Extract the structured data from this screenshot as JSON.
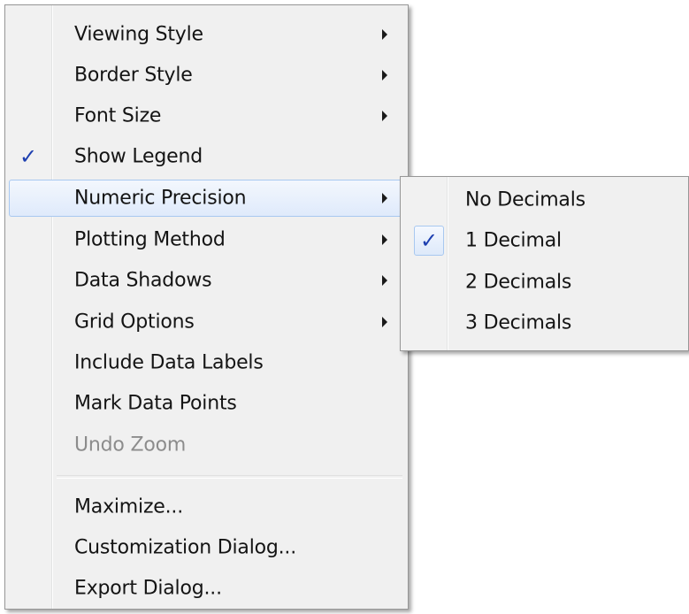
{
  "main_menu": {
    "items": [
      {
        "label": "Viewing Style",
        "has_submenu": true
      },
      {
        "label": "Border Style",
        "has_submenu": true
      },
      {
        "label": "Font Size",
        "has_submenu": true
      },
      {
        "label": "Show Legend",
        "checked": true
      },
      {
        "label": "Numeric Precision",
        "has_submenu": true,
        "highlighted": true
      },
      {
        "label": "Plotting Method",
        "has_submenu": true
      },
      {
        "label": "Data Shadows",
        "has_submenu": true
      },
      {
        "label": "Grid Options",
        "has_submenu": true
      },
      {
        "label": "Include Data Labels"
      },
      {
        "label": "Mark Data Points"
      },
      {
        "label": "Undo Zoom",
        "disabled": true
      },
      {
        "label": "Maximize..."
      },
      {
        "label": "Customization Dialog..."
      },
      {
        "label": "Export Dialog..."
      }
    ],
    "check_glyph": "✓"
  },
  "sub_menu": {
    "parent": "Numeric Precision",
    "items": [
      {
        "label": "No Decimals"
      },
      {
        "label": "1 Decimal",
        "checked": true
      },
      {
        "label": "2 Decimals"
      },
      {
        "label": "3 Decimals"
      }
    ],
    "check_glyph": "✓"
  },
  "colors": {
    "menu_bg": "#f0f0f0",
    "highlight_border": "#a8c8f0",
    "check": "#1d3fb0",
    "disabled_text": "#8c8c8c"
  }
}
